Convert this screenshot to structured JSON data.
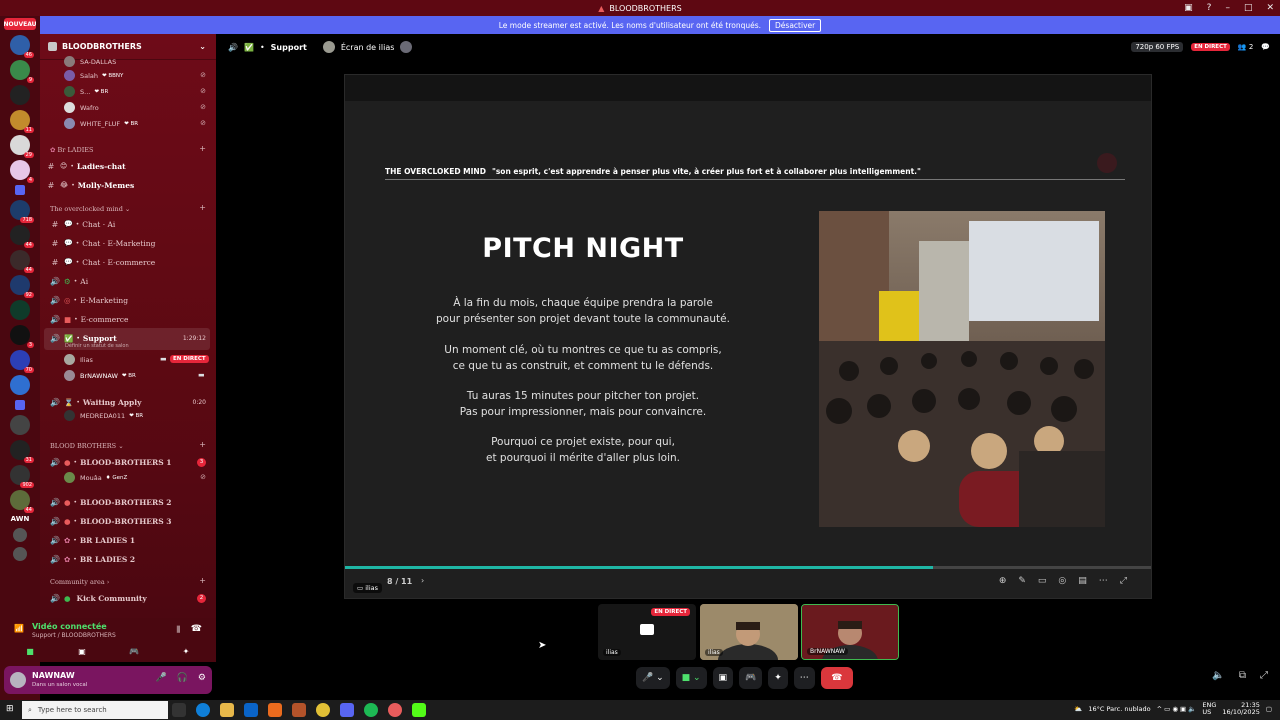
{
  "titlebar": {
    "title": "BLOODBROTHERS"
  },
  "banner": {
    "text": "Le mode streamer est activé. Les noms d'utilisateur ont été tronqués.",
    "button": "Désactiver"
  },
  "rail": {
    "nouveau": "NOUVEAU",
    "badges": [
      "46",
      "9",
      "11",
      "29",
      "4",
      "718",
      "44",
      "44",
      "92",
      "3",
      "52",
      "70",
      "3",
      "1",
      "31",
      "902",
      "44"
    ],
    "awn": "AWN"
  },
  "server": {
    "name": "BLOODBROTHERS"
  },
  "sidebar": {
    "top_users": [
      {
        "name": "SA-DALLAS",
        "tag": ""
      },
      {
        "name": "Salah",
        "tag": "❤ BBNY"
      },
      {
        "name": "S...",
        "tag": "❤ BR"
      },
      {
        "name": "Wafro",
        "tag": ""
      },
      {
        "name": "WHITE_FLUF",
        "tag": "❤ BR"
      }
    ],
    "cat_br_ladies": "Br LADIES",
    "ch_ladies_chat": "Ladies-chat",
    "ch_molly": "Molly-Memes",
    "cat_overclocked": "The overclocked mind",
    "ch_chat_ai": "Chat · Ai",
    "ch_chat_emarketing": "Chat · E-Marketing",
    "ch_chat_ecommerce": "Chat · E-commerce",
    "ch_ai": "Ai",
    "ch_emarketing": "E-Marketing",
    "ch_ecommerce": "E-commerce",
    "ch_support": "Support",
    "support_time": "1:29:12",
    "support_status": "Définir un statut de salon",
    "support_users": [
      {
        "name": "Ilias",
        "tag": ""
      },
      {
        "name": "BrNAWNAW",
        "tag": "❤ BR"
      }
    ],
    "live_badge": "EN DIRECT",
    "ch_waiting": "Waiting Apply",
    "waiting_time": "0:20",
    "waiting_user": {
      "name": "MEDREDA011",
      "tag": "❤ BR"
    },
    "cat_bloodbrothers": "BLOOD BROTHERS",
    "ch_bb1": "BLOOD-BROTHERS 1",
    "bb1_badge": "3",
    "bb1_user": {
      "name": "Mouâa",
      "tag": "♦ GenZ"
    },
    "ch_bb2": "BLOOD-BROTHERS 2",
    "ch_bb3": "BLOOD-BROTHERS 3",
    "ch_brl1": "BR LADIES 1",
    "ch_brl2": "BR LADIES 2",
    "cat_community": "Community area",
    "ch_kick": "Kick Community",
    "kick_badge": "2"
  },
  "voice": {
    "title": "Vidéo connectée",
    "sub": "Support / BLOODBROTHERS"
  },
  "user": {
    "name": "NAWNAW",
    "status": "Dans un salon vocal"
  },
  "header": {
    "channel": "Support",
    "screen": "Écran de ilias",
    "quality": "720p 60 FPS",
    "live": "EN DIRECT",
    "viewers": "2"
  },
  "slide": {
    "brand": "THE OVERCLOKED MIND",
    "quote": "\"son esprit, c'est apprendre  à penser plus vite, à créer plus fort et à collaborer plus intelligemment.\"",
    "title": "PITCH NIGHT",
    "p1a": "À la fin du mois, chaque équipe prendra la parole",
    "p1b": "pour présenter son projet devant toute la communauté.",
    "p2a": "Un moment clé, où tu montres ce que tu as compris,",
    "p2b": "ce que tu as construit, et comment tu le défends.",
    "p3a": "Tu auras 15 minutes pour pitcher ton projet.",
    "p3b": "Pas pour impressionner, mais pour convaincre.",
    "p4a": "Pourquoi ce projet existe, pour qui,",
    "p4b": "et pourquoi il mérite d'aller plus loin.",
    "page": "8 / 11",
    "progress": 0.73,
    "owner": "ilias"
  },
  "tiles": [
    {
      "label": "ilias",
      "live": "EN DIRECT"
    },
    {
      "label": "ilias"
    },
    {
      "label": "BrNAWNAW"
    }
  ],
  "taskbar": {
    "search": "Type here to search",
    "weather": "16°C  Parc. nublado",
    "lang": "ENG",
    "region": "US",
    "time": "21:35",
    "date": "16/10/2025"
  }
}
